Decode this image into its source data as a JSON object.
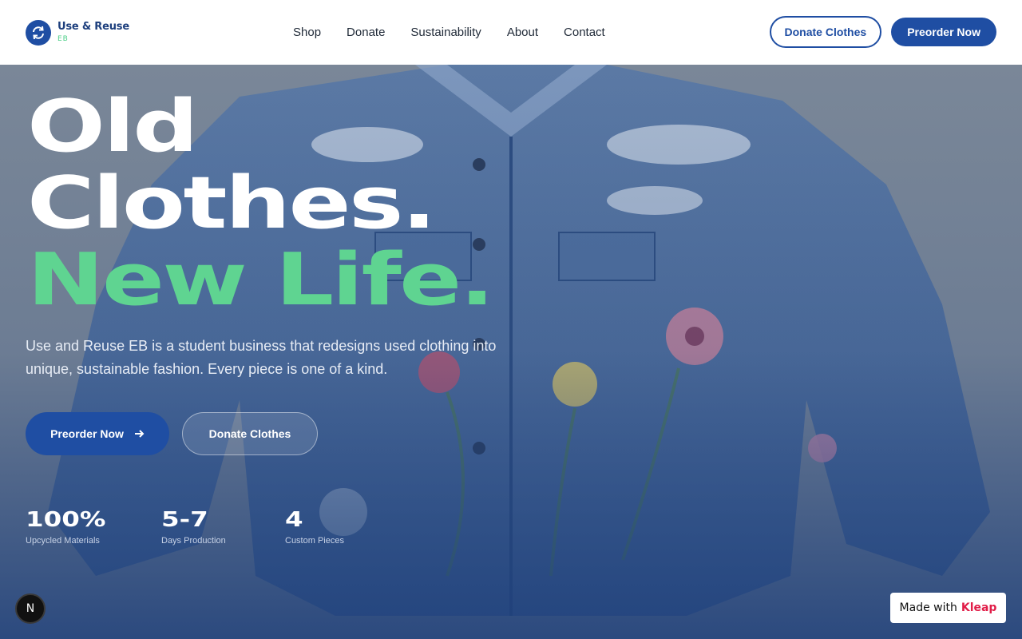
{
  "brand": {
    "name": "Use & Reuse",
    "sub": "EB"
  },
  "nav": [
    "Shop",
    "Donate",
    "Sustainability",
    "About",
    "Contact"
  ],
  "header_actions": {
    "donate": "Donate Clothes",
    "preorder": "Preorder Now"
  },
  "hero": {
    "line1": "Old",
    "line2": "Clothes.",
    "line3": "New Life.",
    "description": "Use and Reuse EB is a student business that redesigns used clothing into unique, sustainable fashion. Every piece is one of a kind.",
    "cta_primary": "Preorder Now",
    "cta_secondary": "Donate Clothes"
  },
  "stats": [
    {
      "value": "100%",
      "label": "Upcycled Materials"
    },
    {
      "value": "5-7",
      "label": "Days Production"
    },
    {
      "value": "4",
      "label": "Custom Pieces"
    }
  ],
  "badge": "N",
  "made_with": {
    "prefix": "Made with",
    "brand": "Kleap"
  },
  "colors": {
    "primary": "#1f4ea3",
    "accent_green": "#5fd491",
    "kleap_pink": "#e11d48"
  }
}
